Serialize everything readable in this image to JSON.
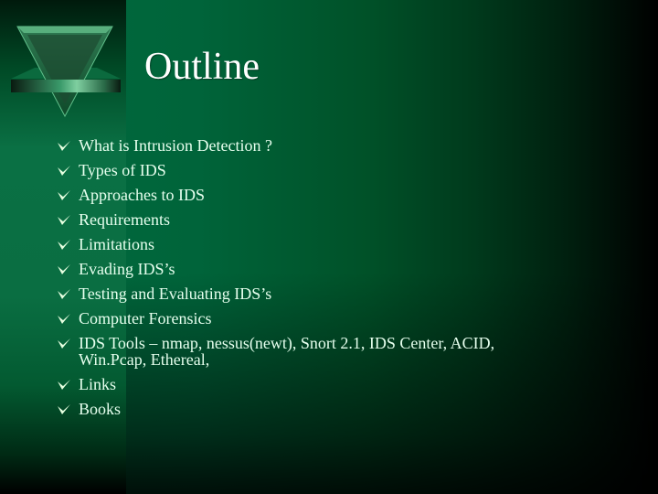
{
  "slide": {
    "title": "Outline",
    "bullet_icon": "check-arrow-icon",
    "items": [
      {
        "text": "What is Intrusion Detection ?"
      },
      {
        "text": "Types of IDS"
      },
      {
        "text": "Approaches to IDS"
      },
      {
        "text": "Requirements"
      },
      {
        "text": "Limitations"
      },
      {
        "text": "Evading IDS’s"
      },
      {
        "text": "Testing and Evaluating IDS’s"
      },
      {
        "text": "Computer Forensics"
      },
      {
        "text": "IDS Tools – nmap, nessus(newt), Snort 2.1, IDS Center, ACID,\nWin.Pcap, Ethereal,"
      },
      {
        "text": "Links"
      },
      {
        "text": "Books"
      }
    ]
  },
  "colors": {
    "title": "#ffffff",
    "text": "#e6ffee",
    "bullet": "#e6ffe0",
    "accent_green": "#00643a"
  }
}
